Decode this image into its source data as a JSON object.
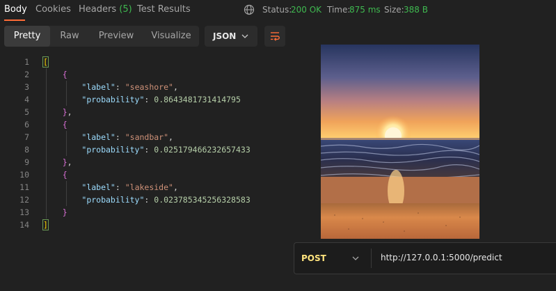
{
  "response_tabs": [
    {
      "label": "Body",
      "active": true
    },
    {
      "label": "Cookies",
      "active": false
    },
    {
      "label": "Headers",
      "count": "(5)",
      "active": false
    },
    {
      "label": "Test Results",
      "active": false
    }
  ],
  "status": {
    "status_label": "Status:",
    "status_value": "200 OK",
    "time_label": "Time:",
    "time_value": "875 ms",
    "size_label": "Size:",
    "size_value": "388 B",
    "value_color": "#3fb950"
  },
  "view_modes": [
    {
      "label": "Pretty",
      "active": true
    },
    {
      "label": "Raw",
      "active": false
    },
    {
      "label": "Preview",
      "active": false
    },
    {
      "label": "Visualize",
      "active": false
    }
  ],
  "format": {
    "selected": "JSON"
  },
  "code_lines": [
    {
      "n": "1"
    },
    {
      "n": "2"
    },
    {
      "n": "3"
    },
    {
      "n": "4"
    },
    {
      "n": "5"
    },
    {
      "n": "6"
    },
    {
      "n": "7"
    },
    {
      "n": "8"
    },
    {
      "n": "9"
    },
    {
      "n": "10"
    },
    {
      "n": "11"
    },
    {
      "n": "12"
    },
    {
      "n": "13"
    },
    {
      "n": "14"
    }
  ],
  "json_body": [
    {
      "label": "seashore",
      "probability": "0.8643481731414795"
    },
    {
      "label": "sandbar",
      "probability": "0.025179466232657433"
    },
    {
      "label": "lakeside",
      "probability": "0.023785345256328583"
    }
  ],
  "json_keys": {
    "label": "\"label\"",
    "probability": "\"probability\""
  },
  "request": {
    "method": "POST",
    "url": "http://127.0.0.1:5000/predict",
    "method_color": "#ffe47e"
  },
  "accent_color": "#ff6c37"
}
